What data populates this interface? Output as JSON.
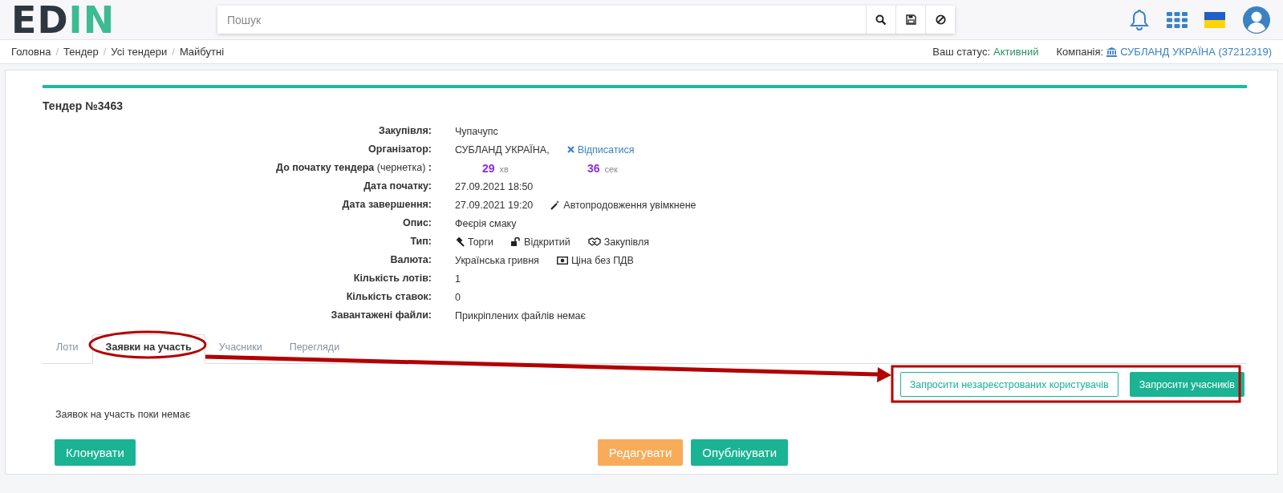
{
  "header": {
    "logo": {
      "dark_part": "ED",
      "accent_part": "IN"
    },
    "search": {
      "placeholder": "Пошук"
    }
  },
  "breadcrumbs": {
    "separator": "/",
    "items": [
      "Головна",
      "Тендер",
      "Усі тендери",
      "Майбутні"
    ]
  },
  "status": {
    "label": "Ваш статус:",
    "value": "Активний"
  },
  "company": {
    "label": "Компанія:",
    "value": "СУБЛАНД УКРАЇНА (37212319)"
  },
  "tender": {
    "title": "Тендер №3463",
    "details": [
      {
        "label": "**Закупівля:**",
        "values": [
          {
            "kind": "text",
            "text": "Чупачупс"
          }
        ]
      },
      {
        "label": "**Організатор:**",
        "values": [
          {
            "kind": "text",
            "text": "СУБЛАНД УКРАЇНА,"
          },
          {
            "kind": "unsubscribe",
            "text": "Відписатися"
          }
        ]
      },
      {
        "label": "**До початку тендера** (чернетка) **:**",
        "values": [
          {
            "kind": "countdown",
            "number": "29",
            "unit": "хв"
          },
          {
            "kind": "countdown",
            "number": "36",
            "unit": "сек"
          }
        ]
      },
      {
        "label": "**Дата початку:**",
        "values": [
          {
            "kind": "text",
            "text": "27.09.2021 18:50"
          }
        ]
      },
      {
        "label": "**Дата завершення:**",
        "values": [
          {
            "kind": "text",
            "text": "27.09.2021 19:20"
          },
          {
            "kind": "auto_extension",
            "text": "Автопродовження увімкнене"
          }
        ]
      },
      {
        "label": "**Опис:**",
        "values": [
          {
            "kind": "text",
            "text": "Феєрія смаку"
          }
        ]
      },
      {
        "label": "**Тип:**",
        "values": [
          {
            "kind": "bidding",
            "text": "Торги"
          },
          {
            "kind": "access",
            "text": "Відкритий"
          },
          {
            "kind": "procurement",
            "text": "Закупівля"
          }
        ]
      },
      {
        "label": "**Валюта:**",
        "values": [
          {
            "kind": "text",
            "text": "Українська гривня"
          },
          {
            "kind": "vat",
            "text": "Ціна без ПДВ"
          }
        ]
      },
      {
        "label": "**Кількість лотів:**",
        "values": [
          {
            "kind": "text",
            "text": "1"
          }
        ]
      },
      {
        "label": "**Кількість ставок:**",
        "values": [
          {
            "kind": "text",
            "text": "0"
          }
        ]
      },
      {
        "label": "**Завантажені файли:**",
        "values": [
          {
            "kind": "text",
            "text": "Прикріплених файлів немає"
          }
        ]
      }
    ]
  },
  "tabs": [
    {
      "label": "Лоти",
      "selected": false
    },
    {
      "label": "Заявки на участь",
      "selected": true
    },
    {
      "label": "Учасники",
      "selected": false
    },
    {
      "label": "Перегляди",
      "selected": false
    }
  ],
  "invite_buttons": [
    {
      "label": "Запросити незареєстрованих користувачів",
      "kind": "outline"
    },
    {
      "label": "Запросити учасників",
      "kind": "primary"
    }
  ],
  "empty_message": "Заявок на участь поки немає",
  "footer_buttons": [
    {
      "label": "Клонувати",
      "kind": "primary"
    },
    {
      "label": "Редагувати",
      "kind": "warning"
    },
    {
      "label": "Опублікувати",
      "kind": "primary"
    }
  ]
}
